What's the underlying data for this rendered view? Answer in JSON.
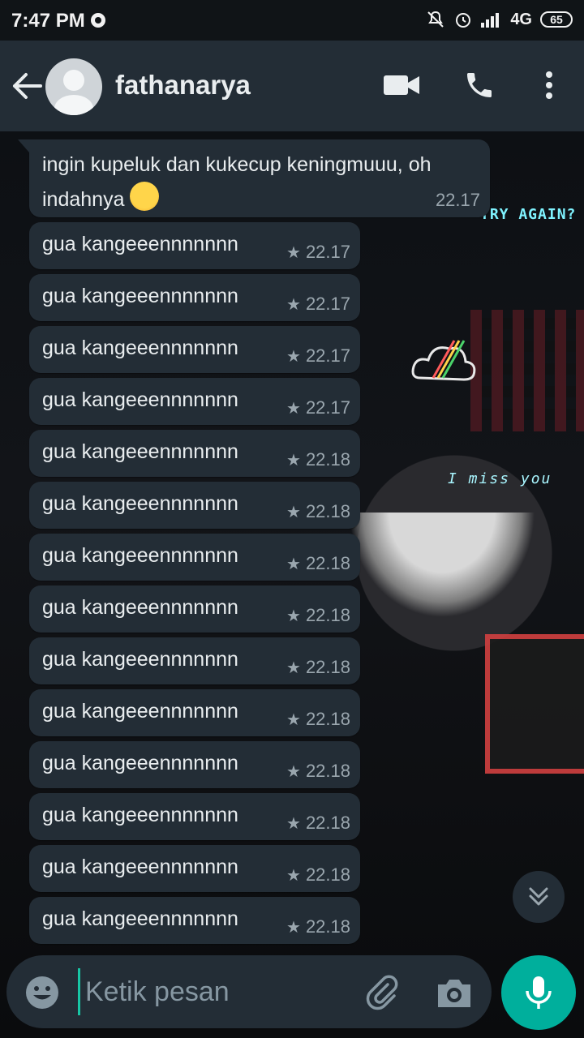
{
  "status_bar": {
    "time": "7:47 PM",
    "network": "4G",
    "battery": "65"
  },
  "header": {
    "contact_name": "fathanarya"
  },
  "wallpaper": {
    "neon_sign": "TRY AGAIN?",
    "neon_caption": "I miss you"
  },
  "messages": [
    {
      "text": "ingin kupeluk dan kukecup keningmuuu, oh indahnya",
      "emoji": "rolling-on-floor-laughing",
      "time": "22.17",
      "starred": false
    },
    {
      "text": "gua kangeeennnnnnn",
      "time": "22.17",
      "starred": true
    },
    {
      "text": "gua kangeeennnnnnn",
      "time": "22.17",
      "starred": true
    },
    {
      "text": "gua kangeeennnnnnn",
      "time": "22.17",
      "starred": true
    },
    {
      "text": "gua kangeeennnnnnn",
      "time": "22.17",
      "starred": true
    },
    {
      "text": "gua kangeeennnnnnn",
      "time": "22.18",
      "starred": true
    },
    {
      "text": "gua kangeeennnnnnn",
      "time": "22.18",
      "starred": true
    },
    {
      "text": "gua kangeeennnnnnn",
      "time": "22.18",
      "starred": true
    },
    {
      "text": "gua kangeeennnnnnn",
      "time": "22.18",
      "starred": true
    },
    {
      "text": "gua kangeeennnnnnn",
      "time": "22.18",
      "starred": true
    },
    {
      "text": "gua kangeeennnnnnn",
      "time": "22.18",
      "starred": true
    },
    {
      "text": "gua kangeeennnnnnn",
      "time": "22.18",
      "starred": true
    },
    {
      "text": "gua kangeeennnnnnn",
      "time": "22.18",
      "starred": true
    },
    {
      "text": "gua kangeeennnnnnn",
      "time": "22.18",
      "starred": true
    },
    {
      "text": "gua kangeeennnnnnn",
      "time": "22.18",
      "starred": true
    }
  ],
  "composer": {
    "placeholder": "Ketik pesan"
  },
  "colors": {
    "header_bg": "#232d36",
    "bubble_bg": "#232d36",
    "accent": "#00af9c"
  }
}
